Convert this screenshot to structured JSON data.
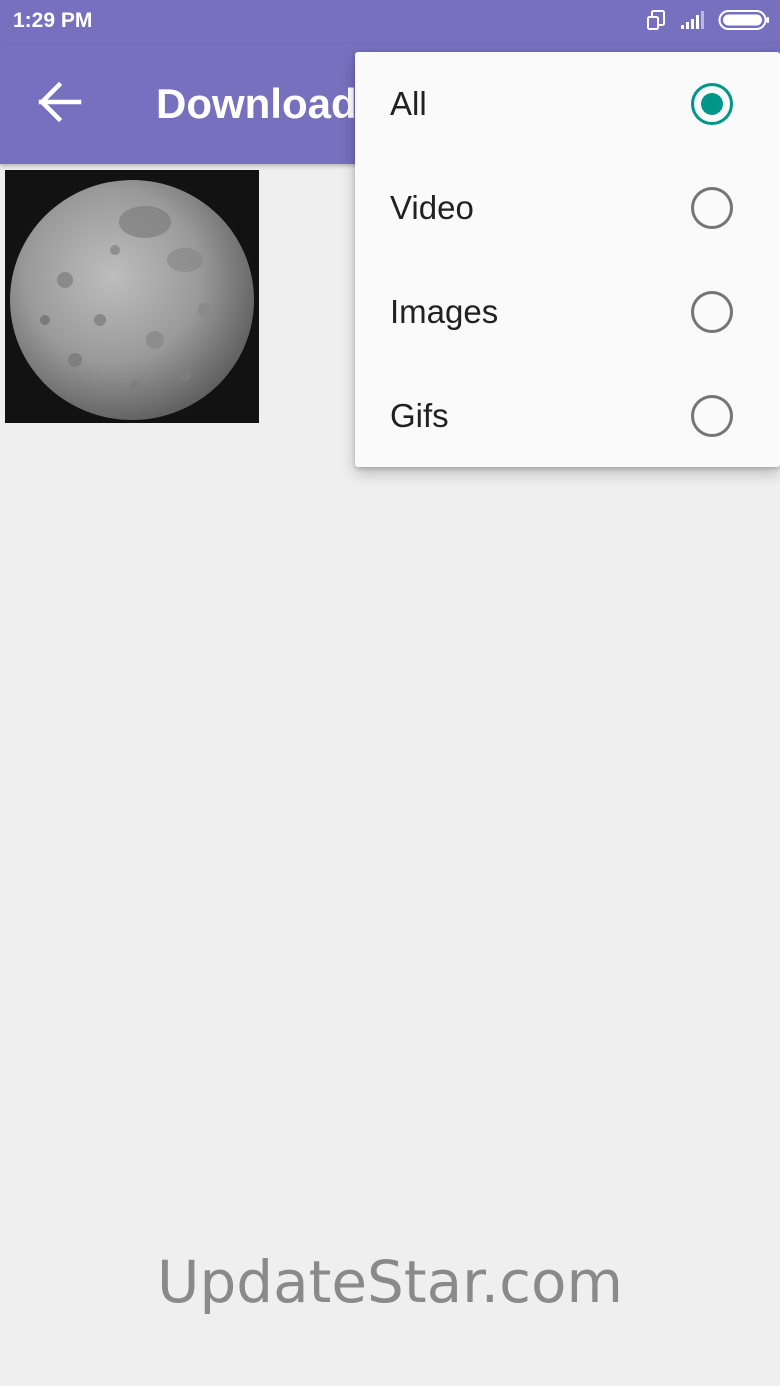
{
  "status_bar": {
    "time": "1:29 PM"
  },
  "app_bar": {
    "title": "Download"
  },
  "filter_menu": {
    "items": [
      {
        "label": "All",
        "checked": true
      },
      {
        "label": "Video",
        "checked": false
      },
      {
        "label": "Images",
        "checked": false
      },
      {
        "label": "Gifs",
        "checked": false
      }
    ]
  },
  "watermark": "UpdateStar.com",
  "colors": {
    "primary": "#7770bf",
    "accent": "#009688",
    "background": "#efefef",
    "menu_background": "#fafafa"
  },
  "icons": [
    "arrow-back-icon",
    "sim-icon",
    "signal-icon",
    "battery-icon"
  ]
}
